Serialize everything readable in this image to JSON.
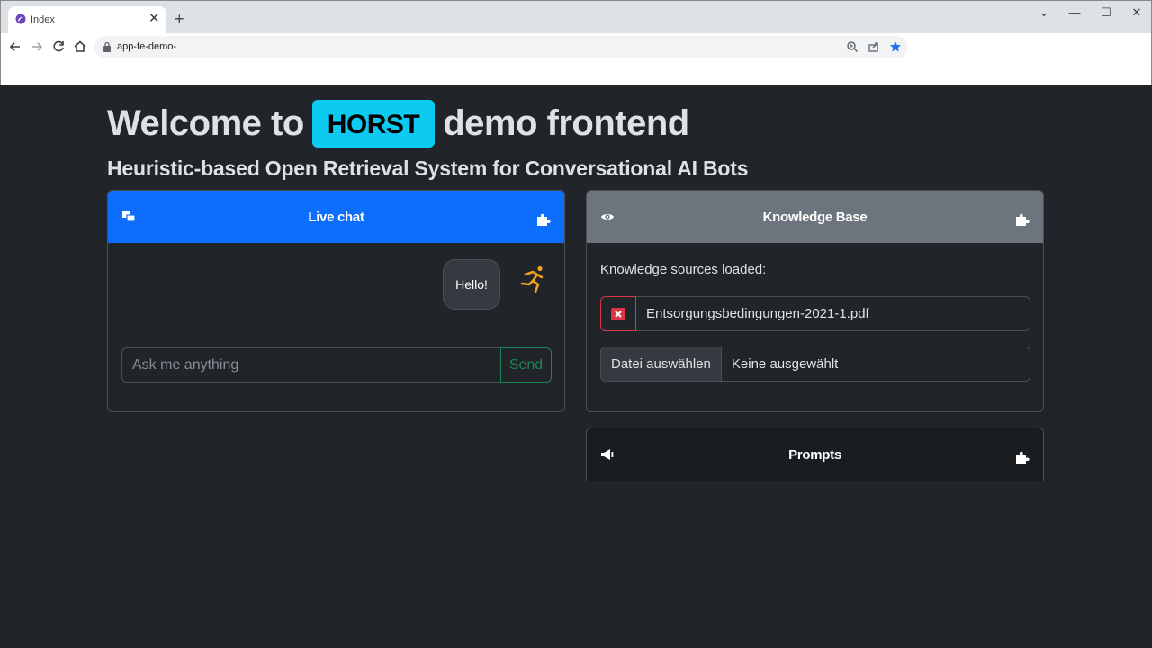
{
  "browser": {
    "tab_title": "Index",
    "tab_close": "✕",
    "new_tab": "+",
    "url": "app-fe-demo-",
    "window_controls": {
      "chevron": "⌄",
      "minimize": "—",
      "maximize": "☐",
      "close": "✕"
    }
  },
  "hero": {
    "title_before": "Welcome to",
    "badge": "HORST",
    "title_after": "demo frontend",
    "subtitle": "Heuristic-based Open Retrieval System for Conversational AI Bots"
  },
  "live_chat": {
    "title": "Live chat",
    "header_color": "#0d6efd",
    "messages": [
      {
        "text": "Hello!"
      }
    ],
    "input_placeholder": "Ask me anything",
    "send_label": "Send"
  },
  "knowledge_base": {
    "title": "Knowledge Base",
    "header_color": "#6c757d",
    "sources_label": "Knowledge sources loaded:",
    "files": [
      {
        "name": "Entsorgungsbedingungen-2021-1.pdf"
      }
    ],
    "file_picker_button": "Datei auswählen",
    "file_picker_value": "Keine ausgewählt"
  },
  "prompts": {
    "title": "Prompts",
    "header_color": "#1a1d20"
  },
  "colors": {
    "page_bg": "#212529",
    "badge": "#0dcaf0",
    "success": "#198754",
    "danger": "#dc3545",
    "avatar": "#f0a020"
  }
}
